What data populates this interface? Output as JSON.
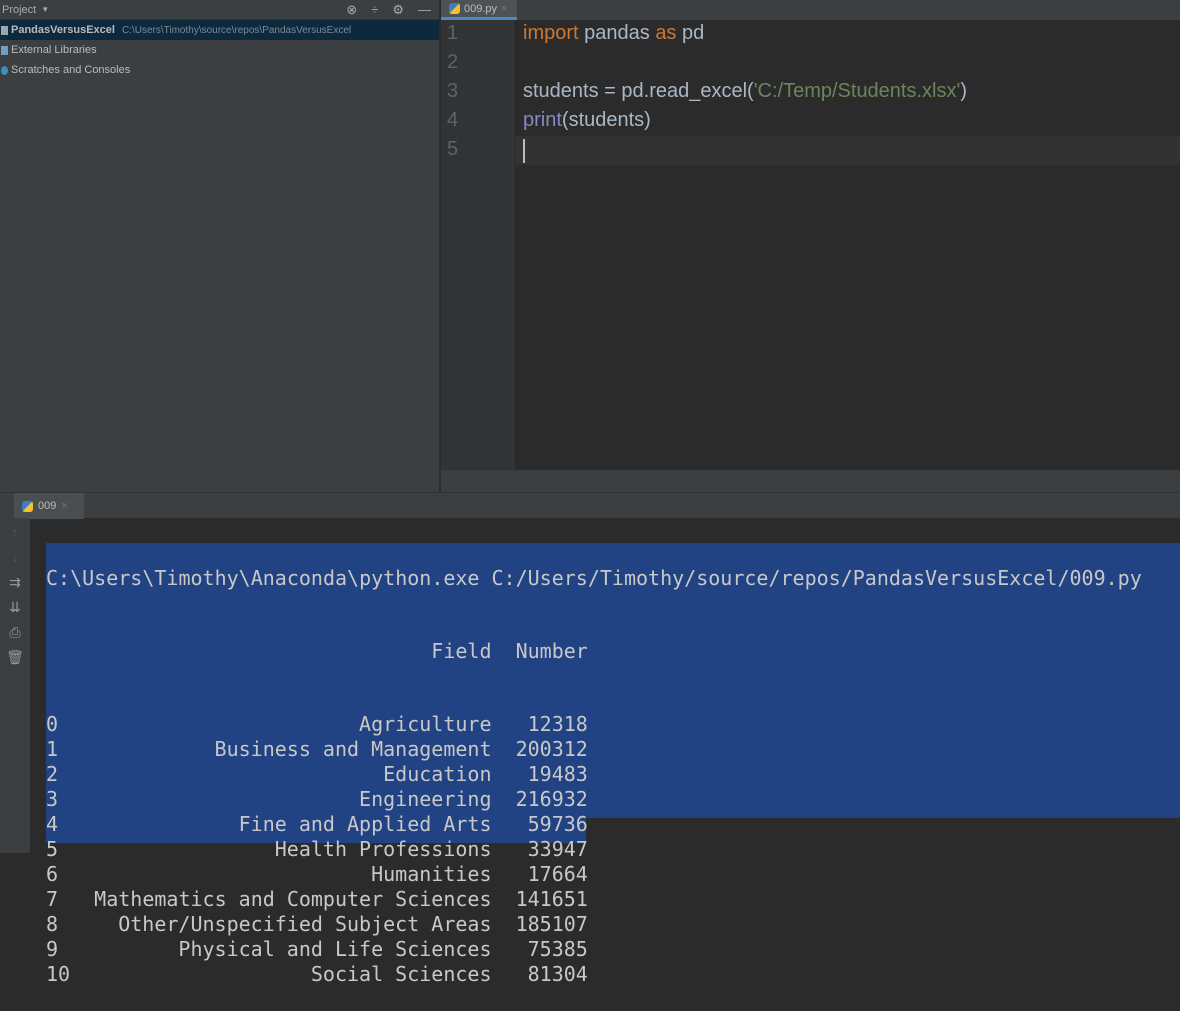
{
  "project_panel": {
    "title": "Project",
    "items": [
      {
        "label": "PandasVersusExcel",
        "path": "C:\\Users\\Timothy\\source\\repos\\PandasVersusExcel"
      },
      {
        "label": "External Libraries"
      },
      {
        "label": "Scratches and Consoles"
      }
    ]
  },
  "editor": {
    "tab": "009.py",
    "line_numbers": [
      "1",
      "2",
      "3",
      "4",
      "5"
    ],
    "code": {
      "l1_kw1": "import",
      "l1_mid": " pandas ",
      "l1_kw2": "as",
      "l1_end": " pd",
      "l3_a": "students = pd.read_excel(",
      "l3_str": "'C:/Temp/Students.xlsx'",
      "l3_b": ")",
      "l4_fn": "print",
      "l4_rest": "(students)"
    }
  },
  "run": {
    "tab": "009",
    "command": "C:\\Users\\Timothy\\Anaconda\\python.exe C:/Users/Timothy/source/repos/PandasVersusExcel/009.py",
    "columns": [
      "Field",
      "Number"
    ],
    "rows": [
      {
        "index": "0",
        "field": "Agriculture",
        "number": "12318"
      },
      {
        "index": "1",
        "field": "Business and Management",
        "number": "200312"
      },
      {
        "index": "2",
        "field": "Education",
        "number": "19483"
      },
      {
        "index": "3",
        "field": "Engineering",
        "number": "216932"
      },
      {
        "index": "4",
        "field": "Fine and Applied Arts",
        "number": "59736"
      },
      {
        "index": "5",
        "field": "Health Professions",
        "number": "33947"
      },
      {
        "index": "6",
        "field": "Humanities",
        "number": "17664"
      },
      {
        "index": "7",
        "field": "Mathematics and Computer Sciences",
        "number": "141651"
      },
      {
        "index": "8",
        "field": "Other/Unspecified Subject Areas",
        "number": "185107"
      },
      {
        "index": "9",
        "field": "Physical and Life Sciences",
        "number": "75385"
      },
      {
        "index": "10",
        "field": "Social Sciences",
        "number": "81304"
      }
    ]
  },
  "colors": {
    "selection": "#214283",
    "keyword": "#cc7832",
    "string": "#6a8759",
    "builtin": "#8888c6"
  }
}
